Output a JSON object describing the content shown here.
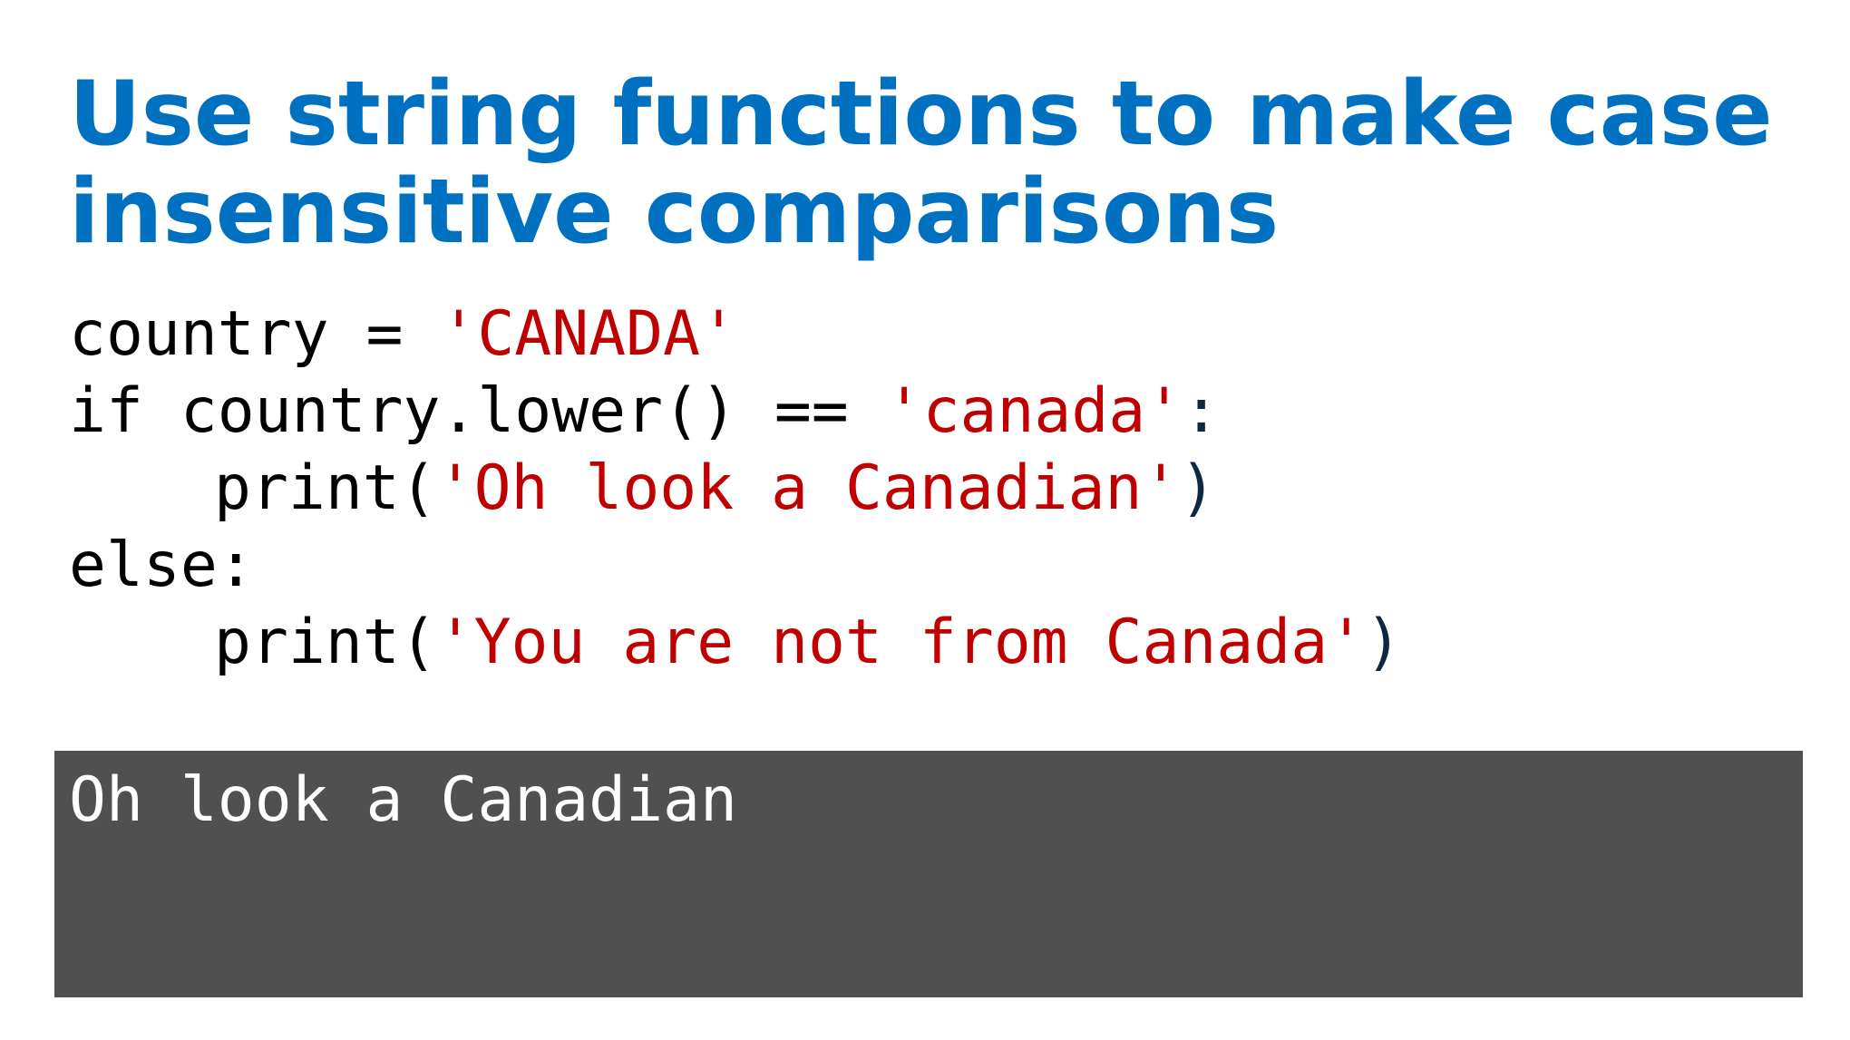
{
  "slide": {
    "title_line1": "Use string functions to make case",
    "title_line2": "insensitive comparisons"
  },
  "code": {
    "line1": {
      "plain": "country = ",
      "string": "'CANADA'"
    },
    "line2": {
      "plain": "if country.lower() == ",
      "string": "'canada'",
      "punct": ":"
    },
    "line3": {
      "plain": "print(",
      "string": "'Oh look a Canadian'",
      "punct": ")"
    },
    "line4": {
      "plain": "else:"
    },
    "line5": {
      "plain": "print(",
      "string": "'You are not from Canada'",
      "punct": ")"
    }
  },
  "output": {
    "text": "Oh look a Canadian"
  },
  "colors": {
    "title": "#0070c0",
    "string_literal": "#c00000",
    "code_text": "#000000",
    "output_background": "#505050",
    "output_text": "#ffffff"
  }
}
